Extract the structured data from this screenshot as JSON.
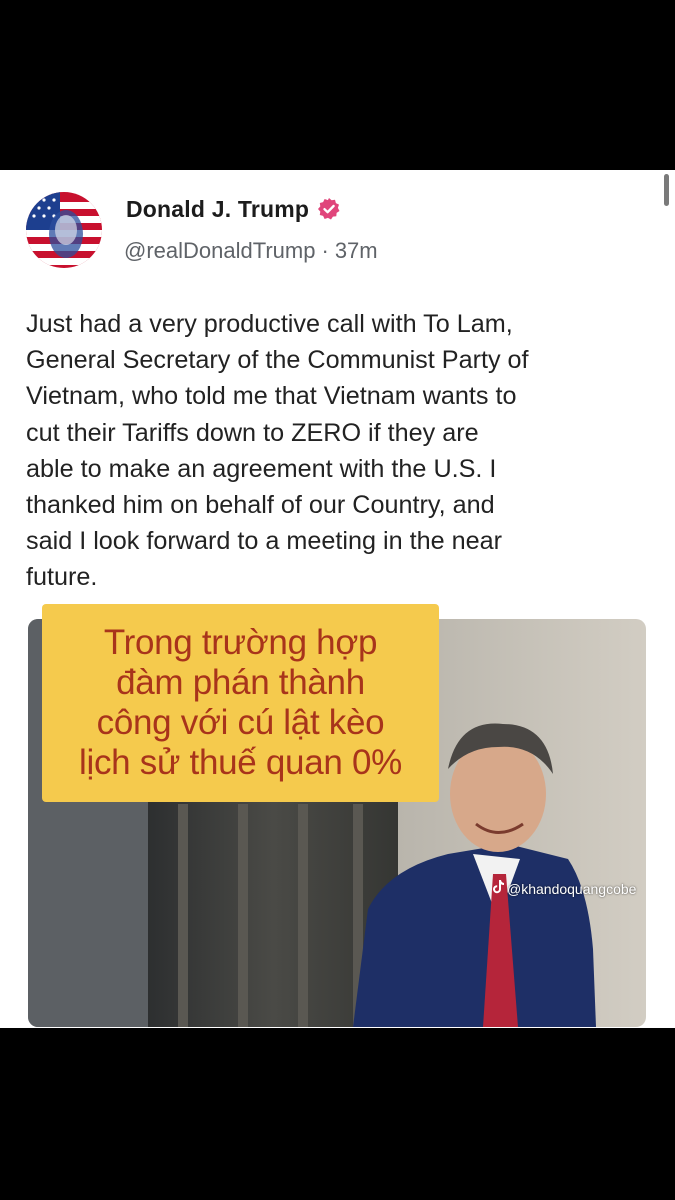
{
  "post": {
    "author_name": "Donald J. Trump",
    "verified_icon": "verified-badge-icon",
    "handle": "@realDonaldTrump",
    "separator": "·",
    "time": "37m",
    "text": "Just had a very productive call with To Lam,\nGeneral Secretary of the Communist Party of\nVietnam, who told me that Vietnam wants to\ncut their Tariffs down to ZERO if they are\nable to make an agreement with the U.S. I\nthanked him on behalf of our Country, and\nsaid I look forward to a meeting in the near\nfuture."
  },
  "overlay": {
    "caption": "Trong trường hợp\nđàm phán thành\ncông với cú lật kèo\nlịch sử thuế quan 0%"
  },
  "watermark": {
    "icon": "tiktok-icon",
    "handle": "@khandoquangcobe"
  },
  "colors": {
    "background": "#000000",
    "card": "#ffffff",
    "badge": "#e0457b",
    "overlay_bg": "#f5ca4d",
    "overlay_text": "#a8341b"
  }
}
